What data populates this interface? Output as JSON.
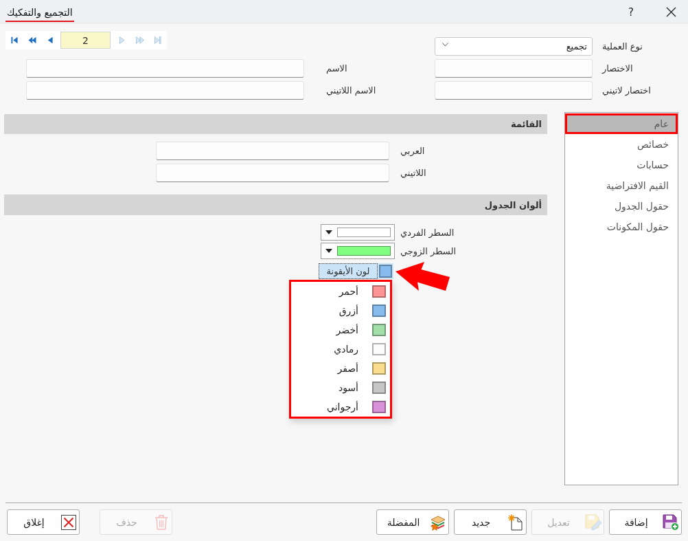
{
  "window": {
    "title": "التجميع والتفكيك",
    "help": "?"
  },
  "navigator": {
    "back": [
      {
        "kind": "first",
        "disabled": false
      },
      {
        "kind": "rewind",
        "disabled": false
      },
      {
        "kind": "previous",
        "disabled": false
      }
    ],
    "record": "2",
    "forward": [
      {
        "kind": "next",
        "disabled": true
      },
      {
        "kind": "fast_forward",
        "disabled": true
      },
      {
        "kind": "last",
        "disabled": true
      }
    ]
  },
  "form": {
    "right_fields": [
      {
        "label": "نوع العملية",
        "kind": "select",
        "value": "تجميع"
      },
      {
        "label": "الاختصار",
        "kind": "text"
      },
      {
        "label": "اختصار لاتيني",
        "kind": "text"
      }
    ],
    "left_fields": [
      {
        "label": "الاسم",
        "kind": "text"
      },
      {
        "label": "الاسم اللاتيني",
        "kind": "text"
      }
    ]
  },
  "sidebar": {
    "items": [
      {
        "label": "عام",
        "selected": true
      },
      {
        "label": "خصائص",
        "selected": false
      },
      {
        "label": "حسابات",
        "selected": false
      },
      {
        "label": "القيم الافتراضية",
        "selected": false
      },
      {
        "label": "حقول الجدول",
        "selected": false
      },
      {
        "label": "حقول المكونات",
        "selected": false
      }
    ]
  },
  "sections": [
    {
      "title": "القائمة",
      "fields": [
        {
          "label": "العربي"
        },
        {
          "label": "اللاتيني"
        }
      ]
    },
    {
      "title": "ألوان الجدول",
      "color_rows": [
        {
          "label": "السطر الفردي",
          "kind": "combo",
          "color": "#ffffff"
        },
        {
          "label": "السطر الزوجي",
          "kind": "combo",
          "color": "#80ff80"
        },
        {
          "label": "لون الأيقونة",
          "kind": "picker",
          "color": "#88bbee",
          "expanded": true,
          "options": [
            {
              "label": "أحمر",
              "color": "#ff9494"
            },
            {
              "label": "أزرق",
              "color": "#88bbee"
            },
            {
              "label": "أخضر",
              "color": "#a2dea8"
            },
            {
              "label": "رمادي",
              "color": "#fcfcfc"
            },
            {
              "label": "أصفر",
              "color": "#f9dc8e"
            },
            {
              "label": "أسود",
              "color": "#c6c6c6"
            },
            {
              "label": "أرجواني",
              "color": "#d892d8"
            }
          ]
        }
      ]
    }
  ],
  "footer": {
    "right_buttons": [
      {
        "kind": "add",
        "label": "إضافة",
        "disabled": false
      },
      {
        "kind": "edit",
        "label": "تعديل",
        "disabled": true
      },
      {
        "kind": "new",
        "label": "جديد",
        "disabled": false
      },
      {
        "kind": "favorites",
        "label": "المفضلة",
        "disabled": false
      }
    ],
    "left_buttons": [
      {
        "kind": "delete",
        "label": "حذف",
        "disabled": true
      },
      {
        "kind": "close",
        "label": "إغلاق",
        "disabled": false
      }
    ]
  }
}
